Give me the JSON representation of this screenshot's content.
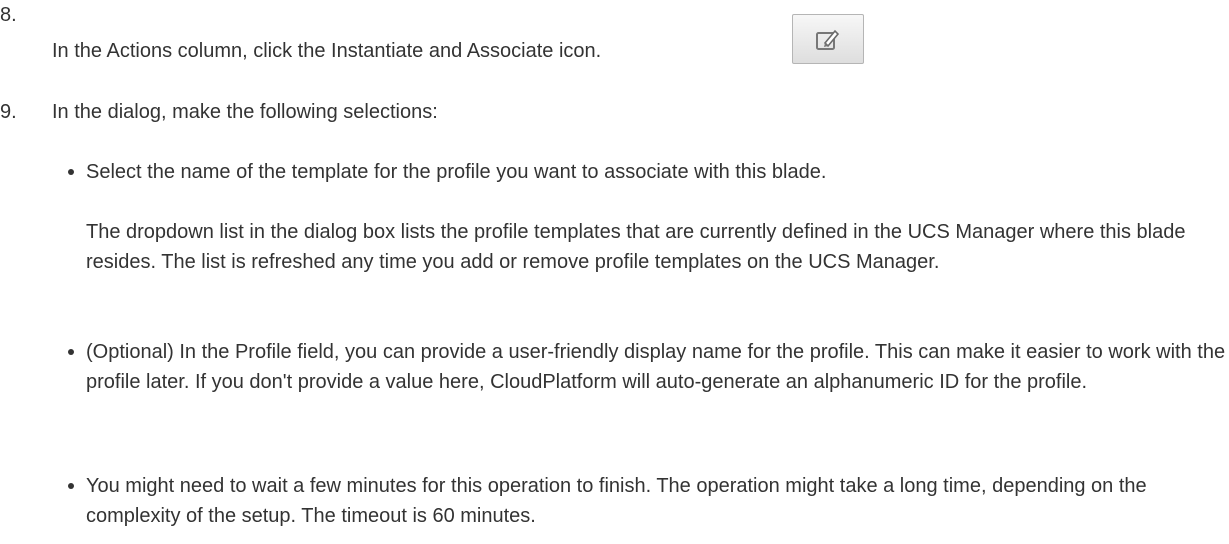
{
  "step8": {
    "number": "8.",
    "text": "In the Actions column, click the Instantiate and Associate icon."
  },
  "step9": {
    "number": "9.",
    "text": "In the dialog, make the following selections:"
  },
  "bullets": [
    "Select the name of the template for the profile you want to associate with this blade.",
    "(Optional) In the Profile field, you can provide a user-friendly display name for the profile. This can make it easier to work with the profile later. If you don't provide a value here, CloudPlatform will auto-generate an alphanumeric ID for the profile.",
    "You might need to wait a few minutes for this operation to finish. The operation might take a long time, depending on the complexity of the setup. The timeout is 60 minutes."
  ],
  "note_paragraph": "The dropdown list in the dialog box lists the profile templates that are currently defined in the UCS Manager where this blade resides. The list is refreshed any time you add or remove profile templates on the UCS Manager.",
  "icons": {
    "action": "instantiate-and-associate-icon"
  }
}
